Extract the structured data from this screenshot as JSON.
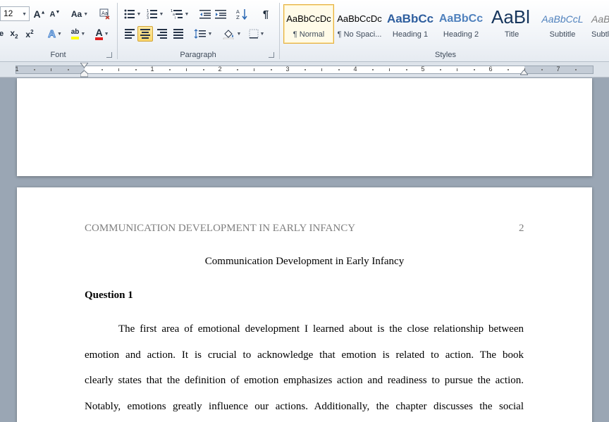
{
  "ribbon": {
    "font_group": {
      "label": "Font",
      "font_size": "12"
    },
    "paragraph_group": {
      "label": "Paragraph"
    },
    "styles_group": {
      "label": "Styles",
      "items": [
        {
          "sample": "AaBbCcDc",
          "name": "¶ Normal",
          "selected": true
        },
        {
          "sample": "AaBbCcDc",
          "name": "¶ No Spaci..."
        },
        {
          "sample": "AaBbCc",
          "name": "Heading 1"
        },
        {
          "sample": "AaBbCc",
          "name": "Heading 2"
        },
        {
          "sample": "AaBl",
          "name": "Title"
        },
        {
          "sample": "AaBbCcL",
          "name": "Subtitle"
        },
        {
          "sample": "AaBbCcL",
          "name": "Subtl"
        }
      ]
    }
  },
  "ruler": {
    "numbers": [
      "1",
      "1",
      "2",
      "3",
      "4",
      "5",
      "6",
      "7"
    ]
  },
  "document": {
    "header_text": "COMMUNICATION DEVELOPMENT IN EARLY INFANCY",
    "page_number": "2",
    "title": "Communication Development in Early Infancy",
    "heading": "Question 1",
    "lines": [
      "The first area of emotional development I learned about is the close relationship between",
      "emotion and action. It is crucial to acknowledge that emotion is related to action. The book",
      "clearly states that the definition of emotion emphasizes action and readiness to pursue the action.",
      "Notably, emotions greatly influence our actions. Additionally, the chapter discusses the social"
    ]
  },
  "colors": {
    "selected_style_border": "#e4b040",
    "align_center_active": "#fbd76a",
    "highlight_yellow": "#ffff00",
    "font_color_red": "#e02020",
    "header_gray": "#7f7f7f"
  }
}
